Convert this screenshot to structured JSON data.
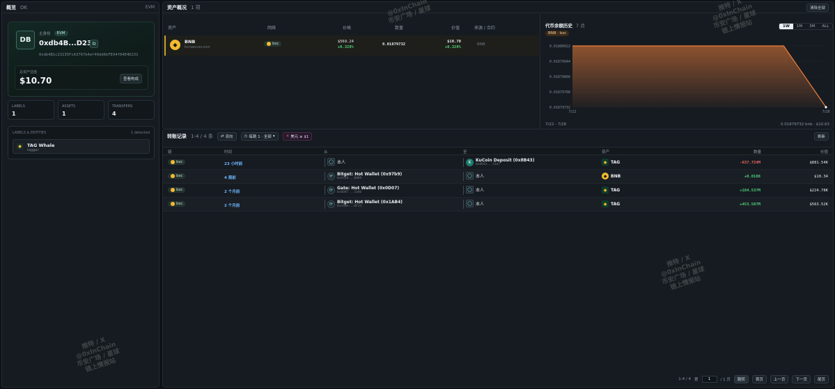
{
  "left": {
    "header": {
      "title": "概览",
      "status": "OK",
      "right": "EVM"
    },
    "avatar": "DB",
    "main_label": "主身份",
    "chain_badge": "EVM",
    "short_address": "0xdb4B...D231",
    "full_address": "0xdb4B1c23135FcA3767b4ef49dd6bFE94f04E4D231",
    "balance_label": "总资产估值",
    "balance": "$10.70",
    "portfolio_button": "查看构成",
    "stats": [
      {
        "label": "LABELS",
        "value": "1"
      },
      {
        "label": "ASSETS",
        "value": "1"
      },
      {
        "label": "TRANSFERS",
        "value": "4"
      }
    ],
    "entities": {
      "title": "LABELS & ENTITIES",
      "count": "1 detected",
      "items": [
        {
          "name": "TAG Whale",
          "tag": "tagger"
        }
      ]
    }
  },
  "assets": {
    "header": {
      "title": "资产概况",
      "count": "1 项",
      "clear": "清除全部"
    },
    "columns": [
      "资产",
      "网络",
      "价格",
      "数量",
      "价值",
      "来源 / 合约"
    ],
    "rows": [
      {
        "symbol": "BNB",
        "name": "binancecoin",
        "network": "bsc",
        "price": "$569.24",
        "price_change": "+0.328%",
        "quantity": "0.01879732",
        "value": "$10.70",
        "value_change": "+0.328%",
        "source": "BNB"
      }
    ]
  },
  "chart_panel": {
    "title": "代币余额历史",
    "count": "7 点",
    "pill": "BNB · bsc",
    "timeframes": [
      "1W",
      "1M",
      "3M",
      "ALL"
    ],
    "active_timeframe": "1W",
    "range": "7/22 - 7/28",
    "current": "0.01879732 bnb · $10.63"
  },
  "chart_data": {
    "type": "area",
    "x": [
      "7/22",
      "7/23",
      "7/24",
      "7/25",
      "7/26",
      "7/27",
      "7/28"
    ],
    "y": [
      0.01880022,
      0.01880022,
      0.01880022,
      0.01880022,
      0.01880022,
      0.01880022,
      0.01879732
    ],
    "y_ticks": [
      "0.01880022",
      "0.01879944",
      "0.01879866",
      "0.01879788",
      "0.01879732"
    ],
    "x_ticks": [
      "7/22",
      "7/28"
    ],
    "ylim": [
      0.01879732,
      0.01880022
    ],
    "color": "#f0803a",
    "grid": true
  },
  "transfers": {
    "header": {
      "title": "转账记录",
      "count": "1-4 / 4 条",
      "flow_button": "流向",
      "filter": "每跳 1 · 全部",
      "min_value": "美元 ≥ $1",
      "refresh": "刷新"
    },
    "columns": [
      "链",
      "时间",
      "从",
      "至",
      "资产",
      "数量",
      "价值"
    ],
    "rows": [
      {
        "chain": "bsc",
        "time": "23 小时前",
        "from_name": "本人",
        "from_addr": "",
        "from_self": true,
        "to_name": "KuCoin Deposit (0x8B43)",
        "to_addr": "0x8B43...51d7",
        "to_self": false,
        "asset": "TAG",
        "amount": "-637.724M",
        "value": "$881.54K"
      },
      {
        "chain": "bsc",
        "time": "4 周前",
        "from_name": "Bitget: Hot Wallet (0x97b9)",
        "from_addr": "0x97b9...8089",
        "from_self": false,
        "to_name": "本人",
        "to_addr": "",
        "to_self": true,
        "asset": "BNB",
        "amount": "+0.0188",
        "value": "$10.34"
      },
      {
        "chain": "bsc",
        "time": "2 个月前",
        "from_name": "Gate: Hot Wallet (0x0D07)",
        "from_addr": "0x0D07...5a06",
        "from_self": false,
        "to_name": "本人",
        "to_addr": "",
        "to_self": true,
        "asset": "TAG",
        "amount": "+184.537M",
        "value": "$224.78K"
      },
      {
        "chain": "bsc",
        "time": "2 个月前",
        "from_name": "Bitget: Hot Wallet (0x1AB4)",
        "from_addr": "0x1AB4...8F23",
        "from_self": false,
        "to_name": "本人",
        "to_addr": "",
        "to_self": true,
        "asset": "TAG",
        "amount": "+453.587M",
        "value": "$563.52K"
      }
    ],
    "pager": {
      "range": "1-4 / 4",
      "goto": "第",
      "page": "1",
      "of": "/ 1 页",
      "jump": "跳转",
      "first": "首页",
      "prev": "上一页",
      "next": "下一页",
      "last": "尾页"
    }
  },
  "watermark": [
    "推特 / X",
    "@0xInChain",
    "币安广场 / 星球",
    "链上情报站"
  ]
}
